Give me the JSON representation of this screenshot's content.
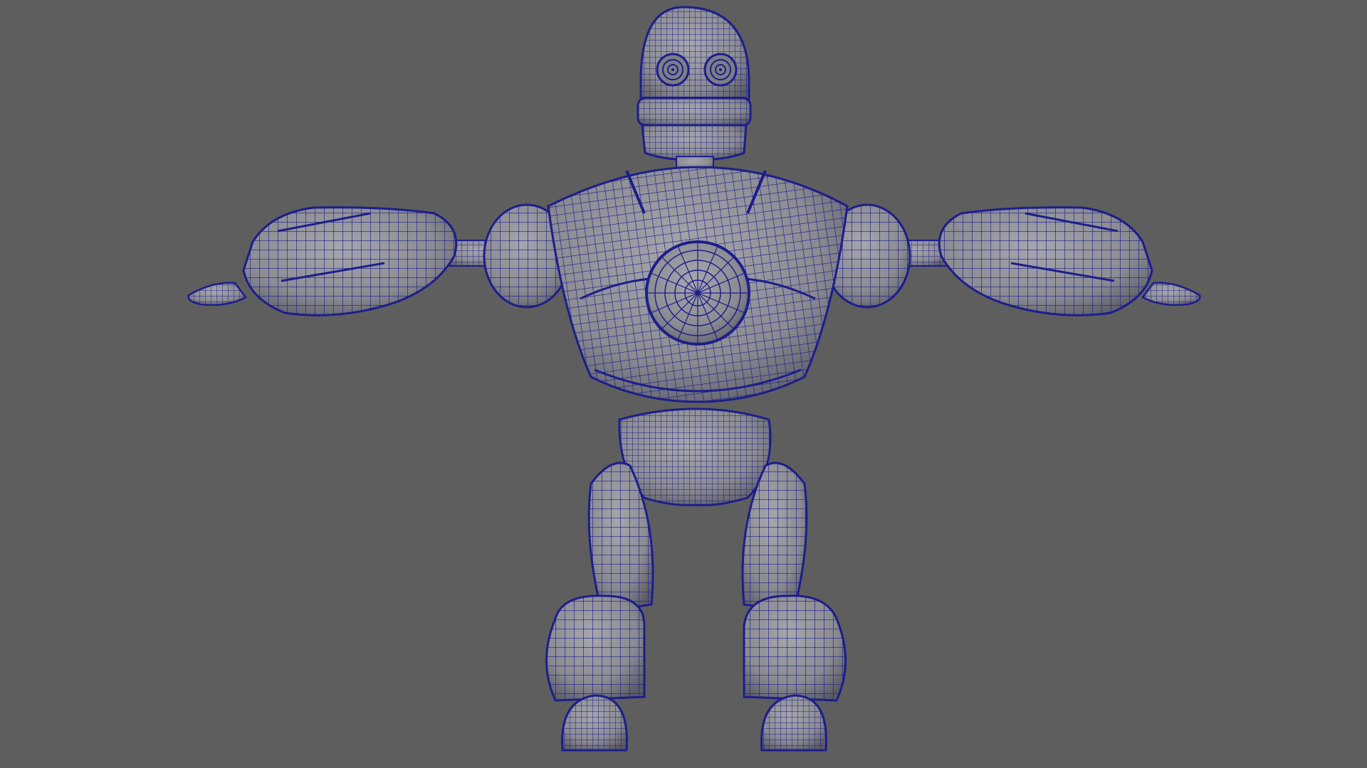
{
  "viewport": {
    "background_color": "#5e5e5e",
    "wire_color": "#1c1e8c",
    "surface_color": "#8b8b92",
    "surface_highlight": "#a6a6ad",
    "surface_shadow": "#5b5b66"
  },
  "model": {
    "type": "robot-character",
    "pose": "t-pose",
    "display_mode": "wireframe-on-shaded",
    "view": "front"
  }
}
